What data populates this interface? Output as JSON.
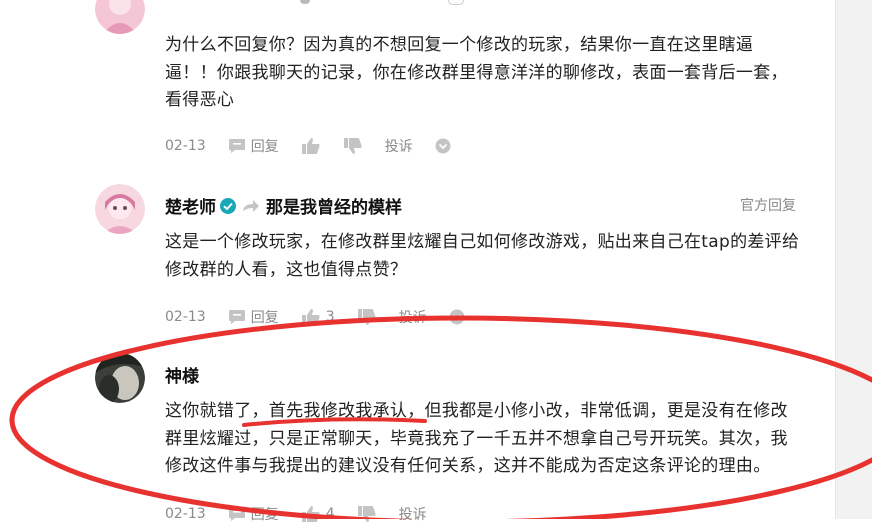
{
  "comments": [
    {
      "text": "为什么不回复你？因为真的不想回复一个修改的玩家，结果你一直在这里瞎逼逼！！你跟我聊天的记录，你在修改群里得意洋洋的聊修改，表面一套背后一套，看得恶心",
      "date": "02-13",
      "reply_label": "回复",
      "report_label": "投诉"
    },
    {
      "author": "楚老师",
      "reply_to": "那是我曾经的模样",
      "badge": "官方回复",
      "text": "这是一个修改玩家，在修改群里炫耀自己如何修改游戏，贴出来自己在tap的差评给修改群的人看，这也值得点赞？",
      "date": "02-13",
      "reply_label": "回复",
      "like_count": "3",
      "report_label": "投诉"
    },
    {
      "author": "神様",
      "text": "这你就错了，首先我修改我承认，但我都是小修小改，非常低调，更是没有在修改群里炫耀过，只是正常聊天，毕竟我充了一千五并不想拿自己号开玩笑。其次，我修改这件事与我提出的建议没有任何关系，这并不能成为否定这条评论的理由。",
      "date": "02-13",
      "reply_label": "回复",
      "like_count": "4",
      "report_label": "投诉"
    }
  ],
  "colors": {
    "annotation_red": "#e8322f",
    "verified": "#1aa7b8",
    "meta_gray": "#8a8a8a"
  }
}
